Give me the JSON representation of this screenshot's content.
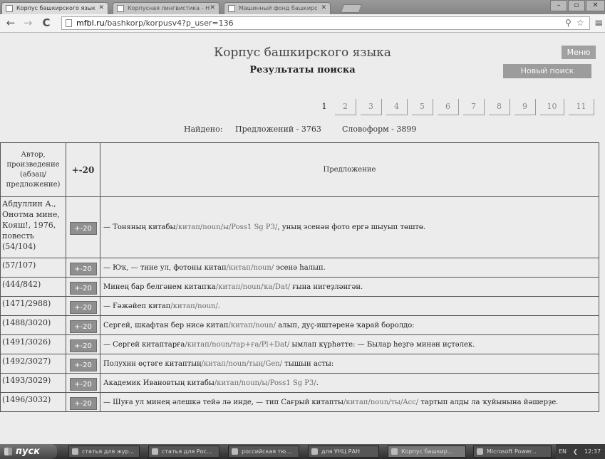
{
  "browser": {
    "tabs": [
      {
        "label": "Корпус башкирского язык"
      },
      {
        "label": "Корпусная лингвистика - Н"
      },
      {
        "label": "Машинный фонд башкирс"
      }
    ],
    "url_host": "mfbl.ru",
    "url_path": "/bashkorp/korpusv4?p_user=136"
  },
  "page": {
    "site_title": "Корпус башкирского языка",
    "menu_label": "Меню",
    "results_title": "Результаты поиска",
    "new_search_label": "Новый поиск",
    "pages": [
      "1",
      "2",
      "3",
      "4",
      "5",
      "6",
      "7",
      "8",
      "9",
      "10",
      "11"
    ],
    "current_page": "1",
    "found_label": "Найдено:",
    "sentences_count": "Предложений - 3763",
    "wordforms_count": "Словоформ - 3899"
  },
  "table": {
    "headers": {
      "author": "Автор, произведение (абзац/ предложение)",
      "context": "+-20",
      "sentence": "Предложение"
    },
    "context_button": "+-20",
    "rows": [
      {
        "ref": "Абдуллин А., Онотма мине, Кояш!, 1976, повесть (54/104)",
        "pre": "— Тоняның ",
        "word": "китабы",
        "gloss": "/китап/noun/ы/Poss1 Sg P3/",
        "post": ", уның эсенән фото ергә шыуып төштө."
      },
      {
        "ref": "(57/107)",
        "pre": "— Юҡ, — тине ул, фотоны ",
        "word": "китап",
        "gloss": "/китап/noun/",
        "post": " эсенә һалып."
      },
      {
        "ref": "(444/842)",
        "pre": "Минең бар белгәнем ",
        "word": "китапҡа",
        "gloss": "/китап/noun/ҡа/Dat/",
        "post": " ғына нигеҙләнгән."
      },
      {
        "ref": "(1471/2988)",
        "pre": "— Ғәжәйеп ",
        "word": "китап",
        "gloss": "/китап/noun/",
        "post": "."
      },
      {
        "ref": "(1488/3020)",
        "pre": "Сергей, шкафтан бер нисә ",
        "word": "китап",
        "gloss": "/китап/noun/",
        "post": " алып, дуҫ-иштәренә ҡарай боролдо:"
      },
      {
        "ref": "(1491/3026)",
        "pre": "— Сергей ",
        "word": "китаптарға",
        "gloss": "/китап/noun/тар+ға/Pl+Dat/",
        "post": " ымлап күрһәтте: — Былар һеҙгә минән иҫтәлек."
      },
      {
        "ref": "(1492/3027)",
        "pre": "Полухин өҫтәге ",
        "word": "китаптың",
        "gloss": "/китап/noun/тың/Gen/",
        "post": " тышын асты:"
      },
      {
        "ref": "(1493/3029)",
        "pre": "Академик Ивановтың ",
        "word": "китабы",
        "gloss": "/китап/noun/ы/Poss1 Sg P3/",
        "post": "."
      },
      {
        "ref": "(1496/3032)",
        "pre": "— Шуға ул минең әлешкә тейә лә инде, — тип Сағрый ",
        "word": "китапты",
        "gloss": "/китап/noun/ты/Acc/",
        "post": " тартып алды ла ҡуйынына йәшерҙе."
      }
    ]
  },
  "taskbar": {
    "start_label": "пуск",
    "items": [
      {
        "label": "статья для жур..."
      },
      {
        "label": "статья для Рос..."
      },
      {
        "label": "российская тю..."
      },
      {
        "label": "для УНЦ РАН"
      },
      {
        "label": "Корпус башкир..."
      },
      {
        "label": "Microsoft Power..."
      }
    ],
    "lang": "EN",
    "clock": "12:37"
  }
}
